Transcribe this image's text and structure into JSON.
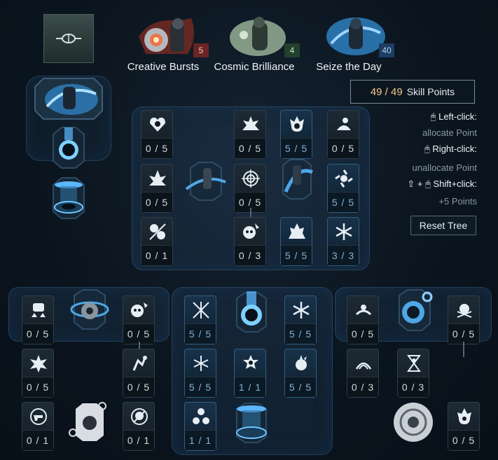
{
  "trees": [
    {
      "name": "Creative Bursts",
      "points": "5",
      "badge_color": "#6a2424"
    },
    {
      "name": "Cosmic Brilliance",
      "points": "4",
      "badge_color": "#22402c"
    },
    {
      "name": "Seize the Day",
      "points": "40",
      "badge_color": "#1d3d62"
    }
  ],
  "skill_points": {
    "value": "49 / 49",
    "label": "Skill Points"
  },
  "help": {
    "left_click_label": "Left-click:",
    "left_click_action": "allocate Point",
    "right_click_label": "Right-click:",
    "right_click_action": "unallocate Point",
    "shift_click_label": "Shift+click:",
    "shift_click_action": "+5 Points"
  },
  "reset_label": "Reset Tree",
  "nodes": {
    "sd_r1c1": "0 / 5",
    "sd_r1c2": "0 / 5",
    "sd_r1c3": "5 / 5",
    "sd_r1c4": "0 / 5",
    "sd_r2c1": "0 / 5",
    "sd_r2c2": "0 / 5",
    "sd_r2c3": "5 / 5",
    "sd_r3c1": "0 / 1",
    "sd_r3c2": "0 / 3",
    "sd_r3c3": "5 / 5",
    "sd_r3c4": "3 / 3",
    "cb_r1c1": "0 / 5",
    "cb_r1c2": "0 / 5",
    "cb_r2c1": "0 / 5",
    "cb_r2c2": "0 / 5",
    "cb_r3c1": "0 / 1",
    "cb_r3c2": "0 / 1",
    "mid_r1c1": "5 / 5",
    "mid_r1c2": "5 / 5",
    "mid_r2c1": "5 / 5",
    "mid_r2c2": "1 / 1",
    "mid_r2c3": "5 / 5",
    "mid_r3c1": "1 / 1",
    "cs_r1c1": "0 / 5",
    "cs_r1c2": "0 / 5",
    "cs_r2c1": "0 / 3",
    "cs_r2c2": "0 / 3",
    "cs_r3c1": "0 / 5"
  },
  "colors": {
    "accent": "#f1c889",
    "maxed": "#7fb2d6",
    "panel": "#264664"
  }
}
